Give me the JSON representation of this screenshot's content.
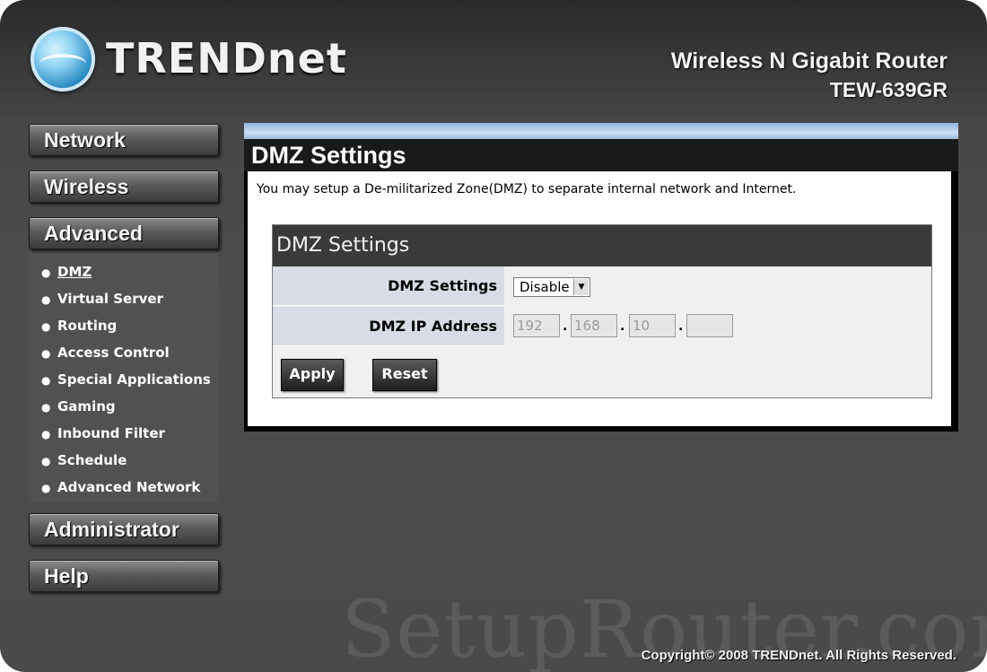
{
  "brand": {
    "logo_text": "TRENDnet",
    "product_name": "Wireless N Gigabit Router",
    "model": "TEW-639GR"
  },
  "nav": {
    "network": "Network",
    "wireless": "Wireless",
    "advanced": "Advanced",
    "administrator": "Administrator",
    "help": "Help",
    "advanced_items": [
      "DMZ",
      "Virtual Server",
      "Routing",
      "Access Control",
      "Special Applications",
      "Gaming",
      "Inbound Filter",
      "Schedule",
      "Advanced Network"
    ]
  },
  "page": {
    "title": "DMZ Settings",
    "description": "You may setup a De-militarized Zone(DMZ) to separate internal network and Internet."
  },
  "panel": {
    "title": "DMZ Settings",
    "dmz_settings_label": "DMZ Settings",
    "dmz_settings_value": "Disable",
    "dmz_ip_label": "DMZ IP Address",
    "ip_octets": [
      "192",
      "168",
      "10",
      ""
    ],
    "apply_label": "Apply",
    "reset_label": "Reset"
  },
  "footer": {
    "copyright": "Copyright© 2008 TRENDnet. All Rights Reserved.",
    "watermark": "SetupRouter.com"
  }
}
